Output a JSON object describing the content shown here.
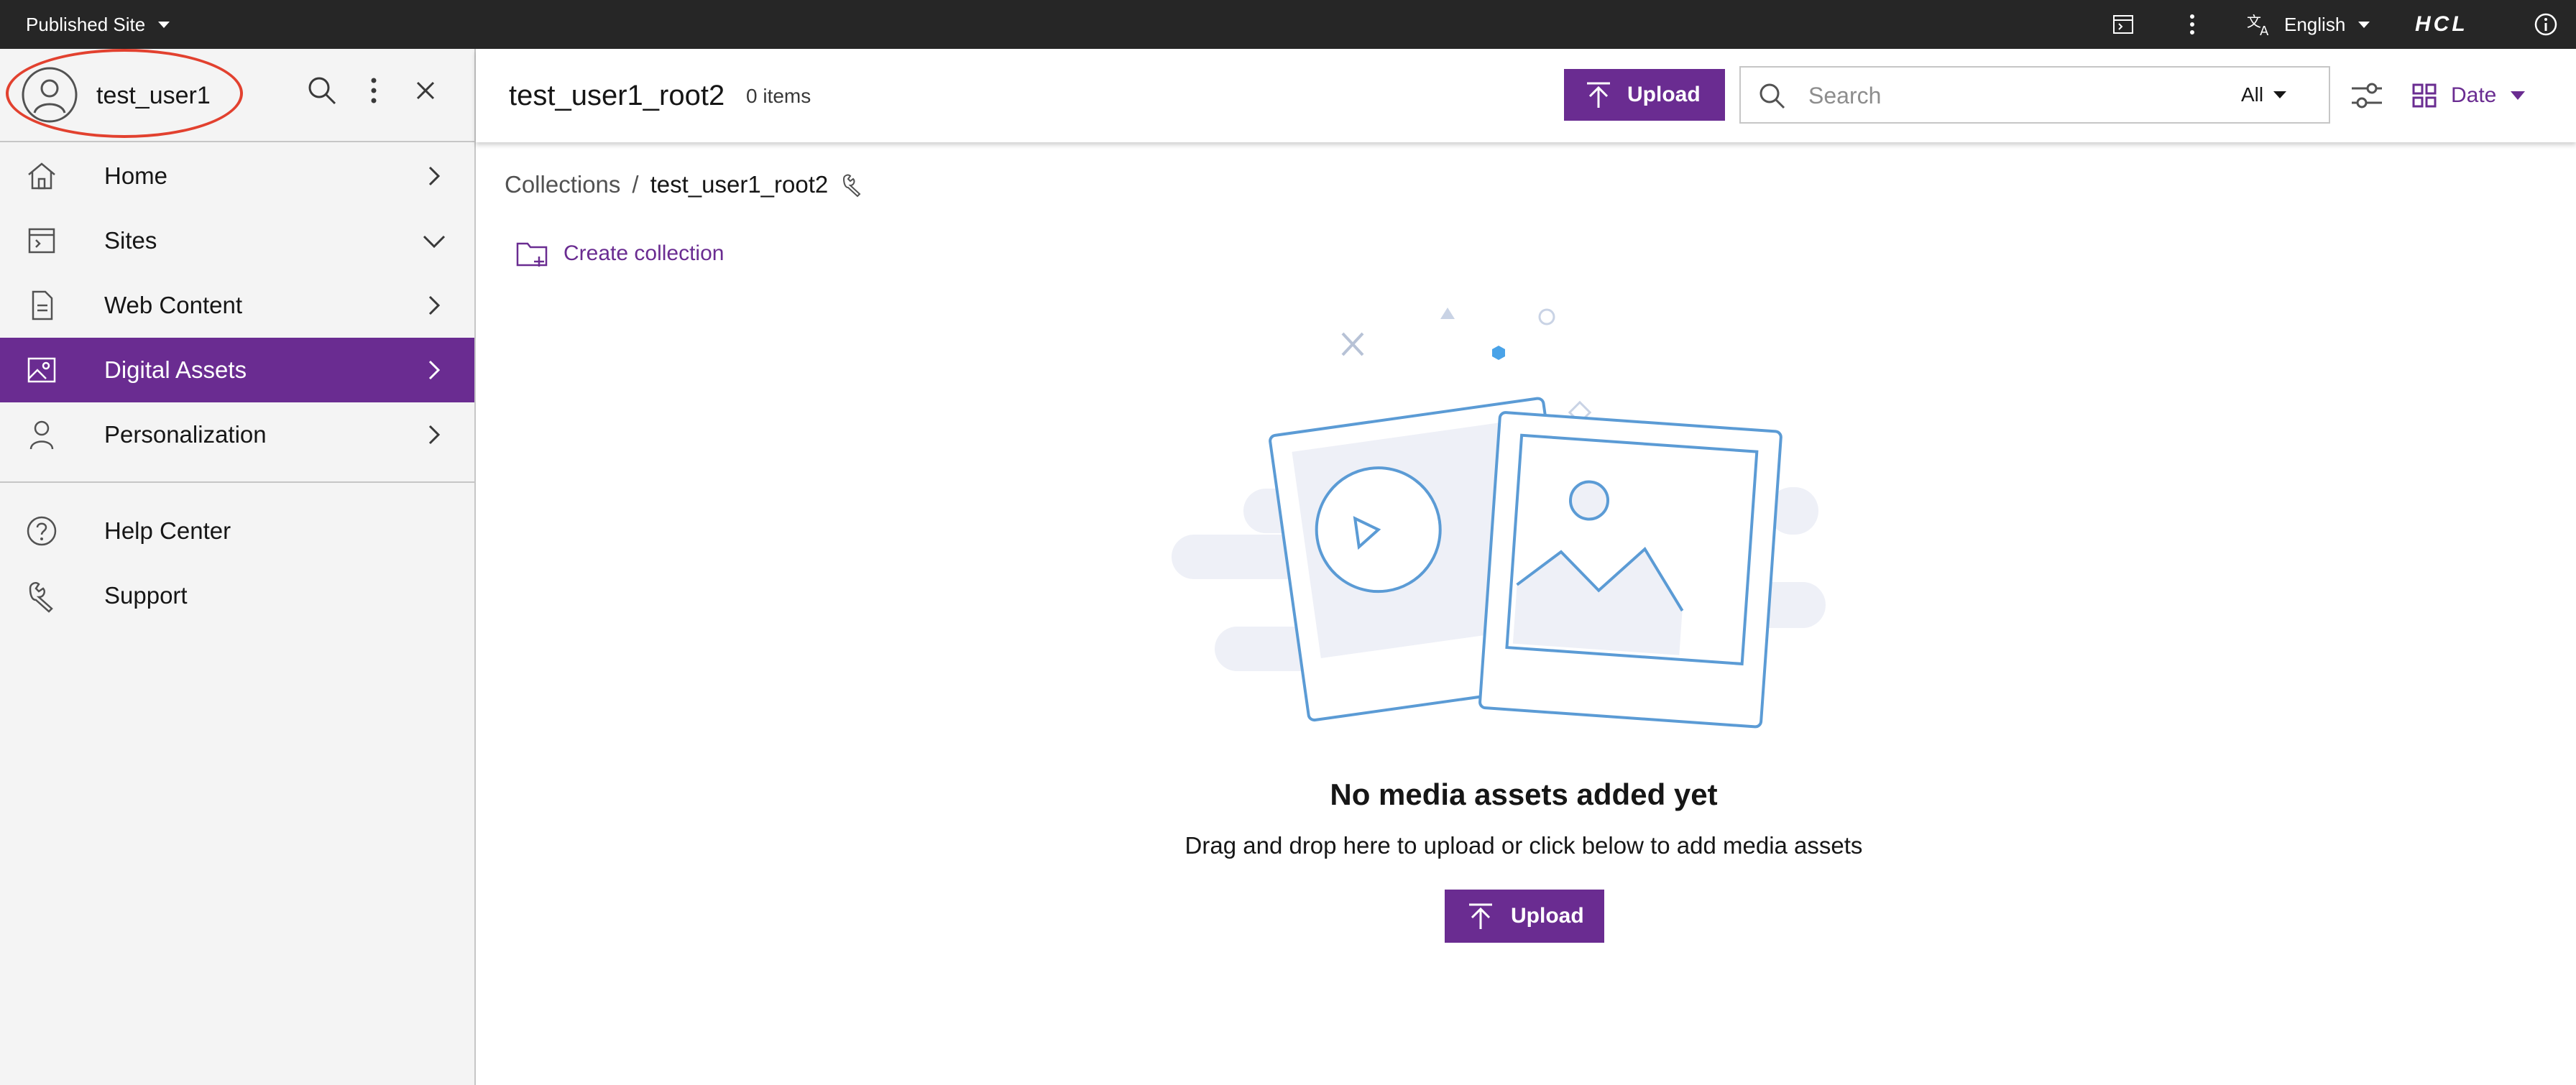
{
  "topbar": {
    "site_label": "Published Site",
    "language": "English",
    "logo": "HCL",
    "icons": [
      "site-preview-icon",
      "overflow-menu-icon",
      "translate-icon",
      "info-icon"
    ]
  },
  "sidebar": {
    "username": "test_user1",
    "items": [
      {
        "label": "Home",
        "icon": "home-icon",
        "chevron": "right"
      },
      {
        "label": "Sites",
        "icon": "sites-icon",
        "chevron": "down"
      },
      {
        "label": "Web Content",
        "icon": "document-icon",
        "chevron": "right"
      },
      {
        "label": "Digital Assets",
        "icon": "image-icon",
        "chevron": "right",
        "active": true
      },
      {
        "label": "Personalization",
        "icon": "person-icon",
        "chevron": "right"
      }
    ],
    "secondary_items": [
      {
        "label": "Help Center",
        "icon": "help-icon"
      },
      {
        "label": "Support",
        "icon": "wrench-icon"
      }
    ]
  },
  "header": {
    "title": "test_user1_root2",
    "count": "0 items",
    "upload_label": "Upload",
    "search_placeholder": "Search",
    "search_scope": "All",
    "sort_label": "Date"
  },
  "breadcrumb": {
    "root": "Collections",
    "separator": "/",
    "current": "test_user1_root2"
  },
  "actions": {
    "create_collection": "Create collection"
  },
  "empty_state": {
    "title": "No media assets added yet",
    "subtitle": "Drag and drop here to upload or click below to add media assets",
    "upload_label": "Upload"
  },
  "colors": {
    "accent": "#6a2c91",
    "topbar_bg": "#262626",
    "sidebar_bg": "#f4f4f4",
    "highlight_ring": "#e2412f",
    "illustration_stroke": "#5b9bd5",
    "illustration_fill": "#eef0f7"
  }
}
